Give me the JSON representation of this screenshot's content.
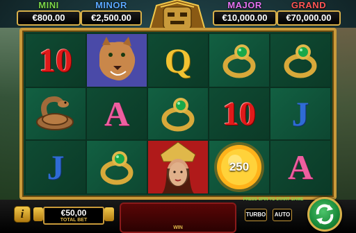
{
  "jackpots": {
    "mini": {
      "label": "MINI",
      "value": "€800.00"
    },
    "minor": {
      "label": "MINOR",
      "value": "€2,500.00"
    },
    "major": {
      "label": "MAJOR",
      "value": "€10,000.00"
    },
    "grand": {
      "label": "GRAND",
      "value": "€70,000.00"
    }
  },
  "reels": {
    "symbols": [
      [
        "10",
        "puma",
        "Q",
        "emerald-ring",
        "emerald-ring"
      ],
      [
        "snake",
        "A",
        "emerald-ring",
        "10",
        "J"
      ],
      [
        "J",
        "emerald-ring",
        "aztec-princess",
        "sun",
        "A"
      ]
    ],
    "labels": {
      "r0c0": "10",
      "r0c2": "Q",
      "r1c1": "A",
      "r1c3": "10",
      "r1c4": "J",
      "r2c0": "J",
      "r2c4": "A"
    },
    "sun_value": "250"
  },
  "controls": {
    "info_label": "i",
    "bet_value": "€50,00",
    "bet_label": "TOTAL BET",
    "win_label": "WIN",
    "press_spin": "PRESS SPIN TO START GAME",
    "turbo_label": "TURBO",
    "auto_label": "AUTO"
  },
  "colors": {
    "frame_gold": "#c99a3a",
    "reel_green": "#0e3f2a",
    "mini": "#7cd84a",
    "minor": "#5aa8ff",
    "major": "#e573f2",
    "grand": "#ff5757"
  }
}
